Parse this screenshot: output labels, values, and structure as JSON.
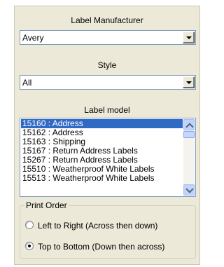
{
  "manufacturer": {
    "label": "Label Manufacturer",
    "value": "Avery"
  },
  "style": {
    "label": "Style",
    "value": "All"
  },
  "label_model": {
    "label": "Label model",
    "items": [
      "15160 : Address",
      "15162 : Address",
      "15163 : Shipping",
      "15167 : Return Address Labels",
      "15267 : Return Address Labels",
      "15510 : Weatherproof White Labels",
      "15513 : Weatherproof White Labels"
    ],
    "selected_index": 0
  },
  "print_order": {
    "label": "Print Order",
    "options": [
      {
        "label": "Left to Right (Across then down)",
        "checked": false
      },
      {
        "label": "Top to Bottom (Down then across)",
        "checked": true
      }
    ]
  }
}
